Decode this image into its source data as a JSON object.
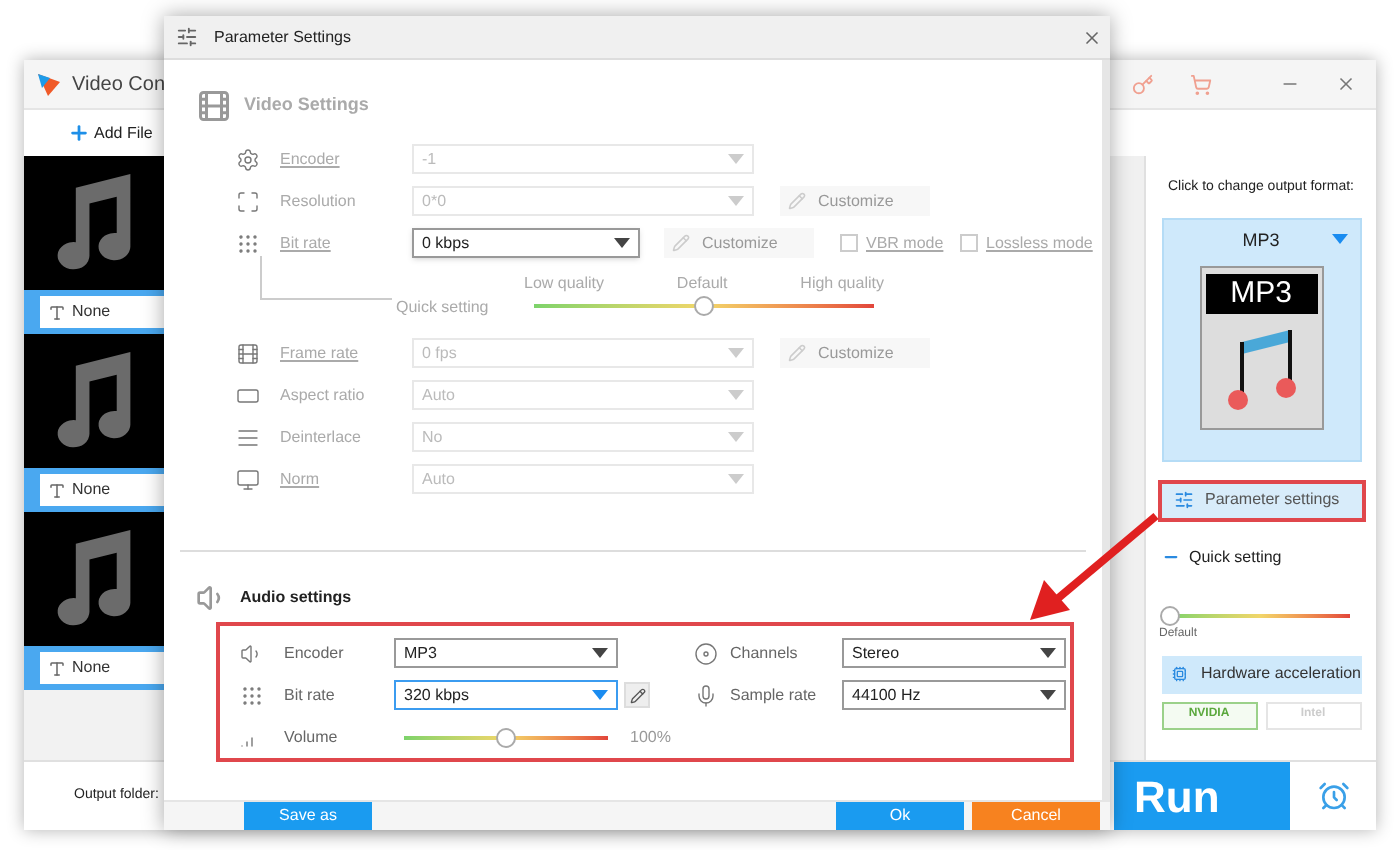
{
  "app": {
    "title": "Video Con",
    "add_button": "Add File",
    "files": [
      {
        "subtitle": "None"
      },
      {
        "subtitle": "None"
      },
      {
        "subtitle": "None"
      }
    ],
    "output_folder_label": "Output folder:",
    "format_prompt": "Click to change output format:",
    "format": {
      "name": "MP3",
      "icon_label": "MP3"
    },
    "parameter_button": "Parameter settings",
    "quick_setting": {
      "label": "Quick setting",
      "level": 0,
      "default_label": "Default"
    },
    "hardware": {
      "label": "Hardware acceleration",
      "options": [
        {
          "label": "NVIDIA",
          "selected": true
        },
        {
          "label": "Intel",
          "selected": false
        }
      ]
    },
    "run_button": "Run"
  },
  "dialog": {
    "title": "Parameter Settings",
    "video_settings": {
      "title": "Video Settings",
      "rows": [
        {
          "kind": "select",
          "label": "Encoder",
          "link": true,
          "value": "-1",
          "disabled": true
        },
        {
          "kind": "select",
          "label": "Resolution",
          "link": false,
          "value": "0*0",
          "disabled": true,
          "customize": "Customize"
        },
        {
          "kind": "bitrate",
          "label": "Bit rate",
          "link": true,
          "value": "0 kbps",
          "disabled": false,
          "customize": "Customize",
          "options": [
            {
              "label": "VBR mode",
              "checked": false
            },
            {
              "label": "Lossless mode",
              "checked": false
            }
          ]
        },
        {
          "kind": "quality",
          "label": "Quick setting",
          "marks": [
            "Low quality",
            "Default",
            "High quality"
          ],
          "level": 0.5
        },
        {
          "kind": "select",
          "label": "Frame rate",
          "link": true,
          "value": "0 fps",
          "disabled": true,
          "customize": "Customize"
        },
        {
          "kind": "select",
          "label": "Aspect ratio",
          "link": false,
          "value": "Auto",
          "disabled": true
        },
        {
          "kind": "select",
          "label": "Deinterlace",
          "link": false,
          "value": "No",
          "disabled": true
        },
        {
          "kind": "select",
          "label": "Norm",
          "link": true,
          "value": "Auto",
          "disabled": true
        }
      ]
    },
    "audio_settings": {
      "title": "Audio settings",
      "left": [
        {
          "kind": "select",
          "label": "Encoder",
          "value": "MP3",
          "focused": false
        },
        {
          "kind": "select",
          "label": "Bit rate",
          "value": "320 kbps",
          "focused": true,
          "editable": true
        },
        {
          "kind": "slider",
          "label": "Volume",
          "level": 0.5,
          "reading": "100%"
        }
      ],
      "right": [
        {
          "kind": "select",
          "label": "Channels",
          "value": "Stereo",
          "focused": false
        },
        {
          "kind": "select",
          "label": "Sample rate",
          "value": "44100 Hz",
          "focused": false
        }
      ]
    },
    "buttons": [
      {
        "kind": "save",
        "label": "Save as"
      },
      {
        "kind": "ok",
        "label": "Ok"
      },
      {
        "kind": "cancel",
        "label": "Cancel"
      }
    ]
  }
}
